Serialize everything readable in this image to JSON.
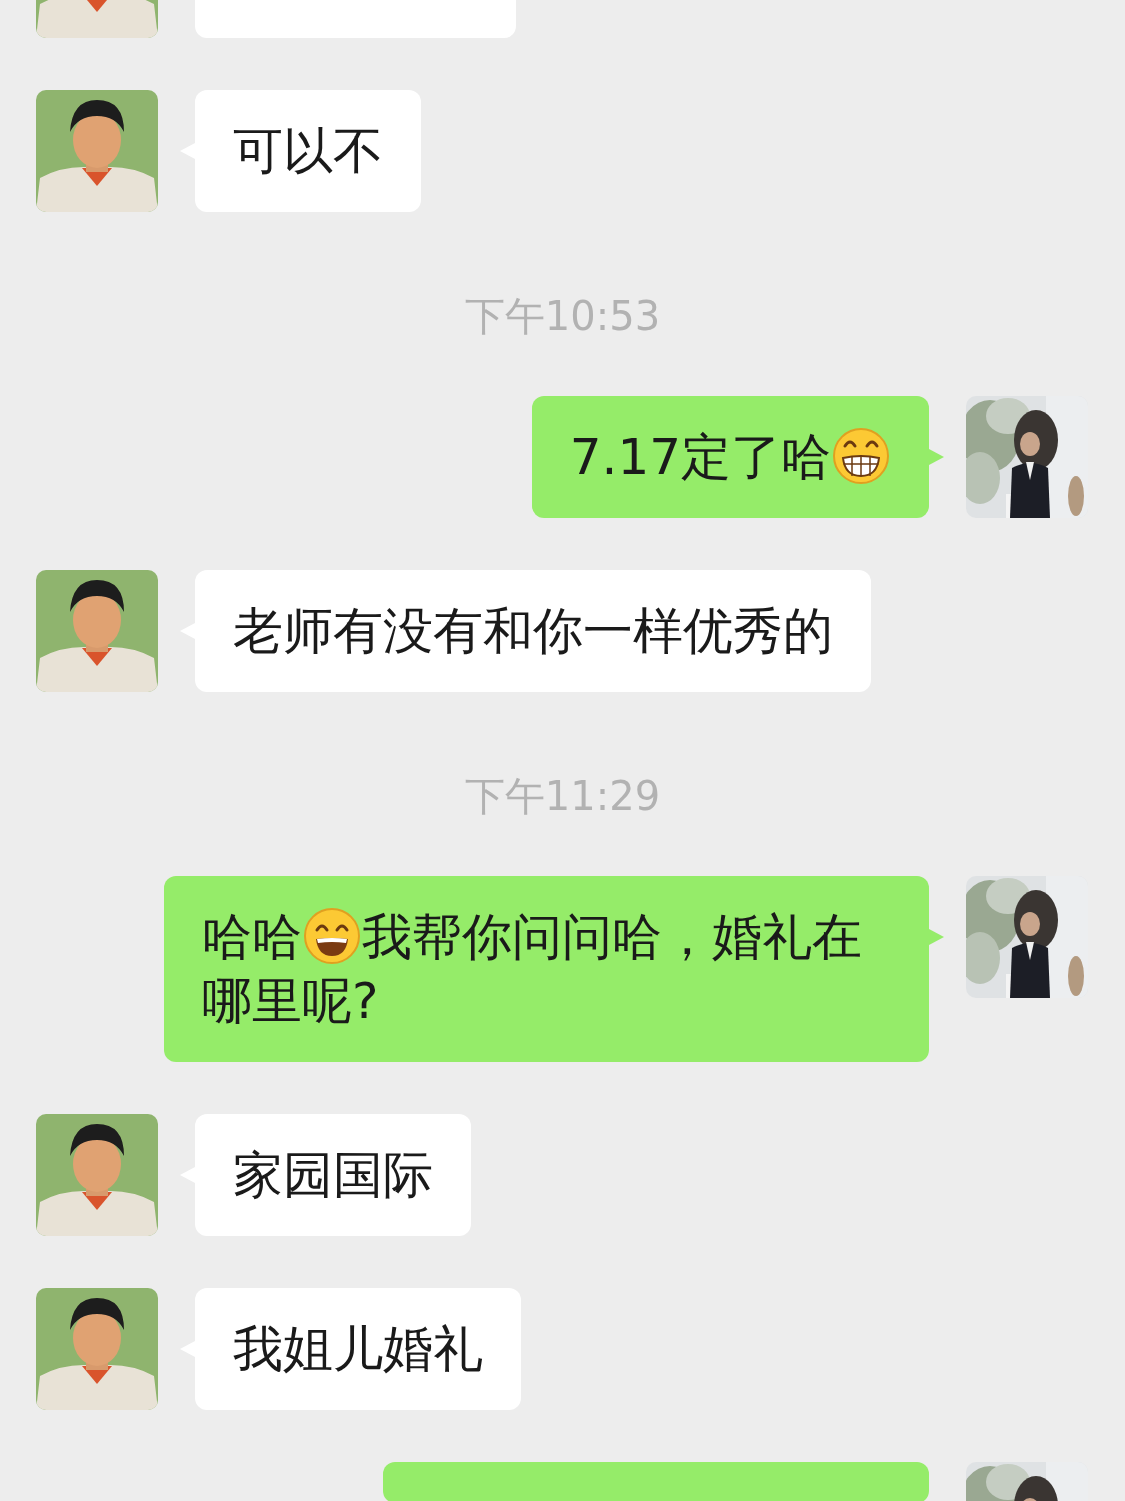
{
  "messages": [
    {
      "kind": "cut",
      "outgoing": false
    },
    {
      "kind": "message",
      "outgoing": false,
      "parts": [
        {
          "kind": "text",
          "text": "可以不"
        }
      ]
    },
    {
      "kind": "time",
      "text": "下午10:53"
    },
    {
      "kind": "message",
      "outgoing": true,
      "parts": [
        {
          "kind": "text",
          "text": "7.17定了哈"
        },
        {
          "kind": "grin"
        }
      ]
    },
    {
      "kind": "message",
      "outgoing": false,
      "parts": [
        {
          "kind": "text",
          "text": "老师有没有和你一样优秀的"
        }
      ]
    },
    {
      "kind": "time",
      "text": "下午11:29"
    },
    {
      "kind": "message",
      "outgoing": true,
      "parts": [
        {
          "kind": "text",
          "text": "哈哈"
        },
        {
          "kind": "smile"
        },
        {
          "kind": "text",
          "text": "我帮你问问哈，婚礼在哪里呢?"
        }
      ]
    },
    {
      "kind": "message",
      "outgoing": false,
      "parts": [
        {
          "kind": "text",
          "text": "家园国际"
        }
      ]
    },
    {
      "kind": "message",
      "outgoing": false,
      "parts": [
        {
          "kind": "text",
          "text": "我姐儿婚礼"
        }
      ]
    },
    {
      "kind": "cut",
      "outgoing": true
    }
  ]
}
